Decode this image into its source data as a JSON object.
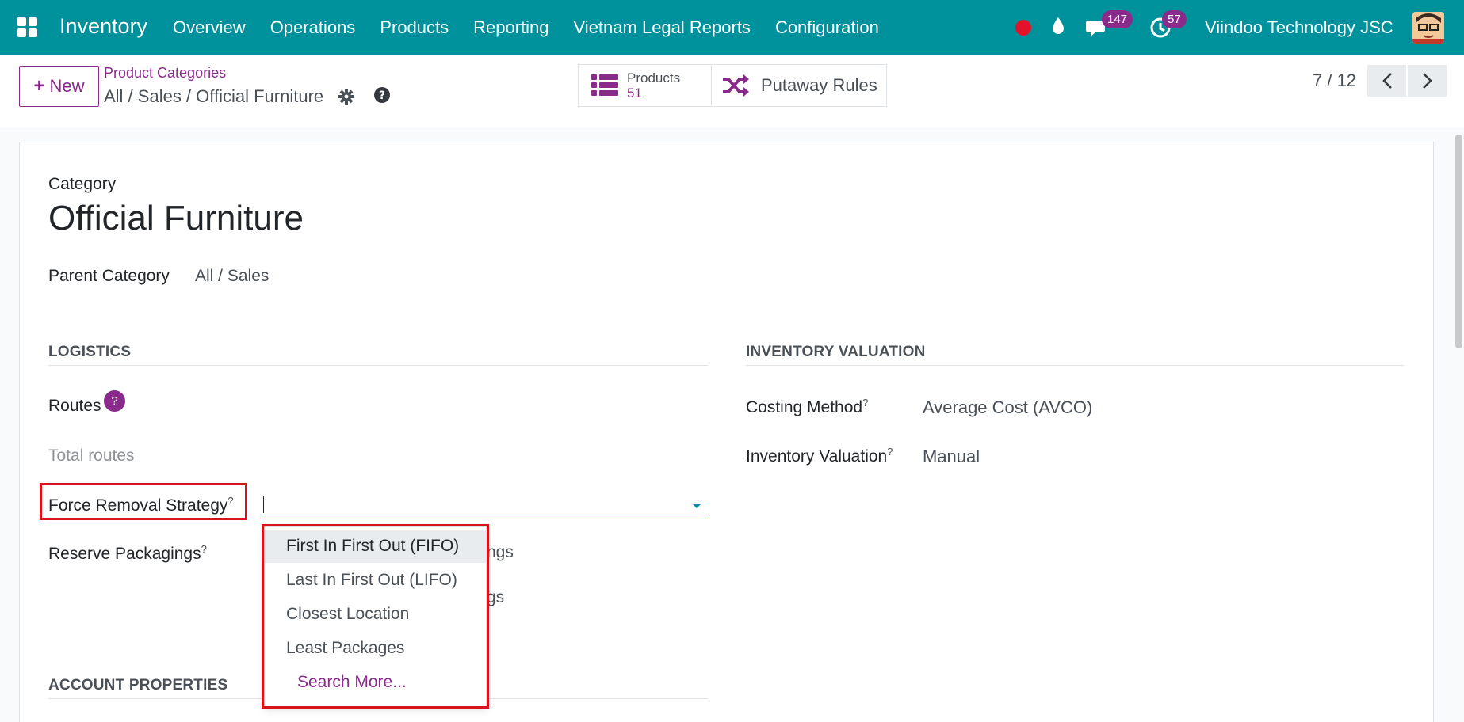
{
  "nav": {
    "app_name": "Inventory",
    "menu": [
      "Overview",
      "Operations",
      "Products",
      "Reporting",
      "Vietnam Legal Reports",
      "Configuration"
    ],
    "messages_count": "147",
    "activities_count": "57",
    "company": "Viindoo Technology JSC"
  },
  "control_panel": {
    "new_label": "New",
    "breadcrumb_parent": "Product Categories",
    "breadcrumb_current": "All / Sales / Official Furniture",
    "smart_products_label": "Products",
    "smart_products_count": "51",
    "smart_putaway_label": "Putaway Rules",
    "pager": "7 / 12"
  },
  "form": {
    "category_label": "Category",
    "title": "Official Furniture",
    "parent_label": "Parent Category",
    "parent_value": "All / Sales",
    "logistics": {
      "title": "LOGISTICS",
      "routes_label": "Routes",
      "routes_help": "?",
      "total_routes": "Total routes",
      "force_removal_label": "Force Removal Strategy",
      "reserve_packagings_label": "Reserve Packagings",
      "reserve_behind_1": "ngs",
      "reserve_behind_2": "gs"
    },
    "valuation": {
      "title": "INVENTORY VALUATION",
      "costing_label": "Costing Method",
      "costing_value": "Average Cost (AVCO)",
      "valuation_label": "Inventory Valuation",
      "valuation_value": "Manual"
    },
    "account_title": "ACCOUNT PROPERTIES",
    "help_mark": "?"
  },
  "dropdown": {
    "options": [
      "First In First Out (FIFO)",
      "Last In First Out (LIFO)",
      "Closest Location",
      "Least Packages"
    ],
    "search_more": "Search More..."
  },
  "colors": {
    "navbar": "#00929c",
    "brand_purple": "#8a2b8c",
    "highlight_red": "#d7141c"
  }
}
